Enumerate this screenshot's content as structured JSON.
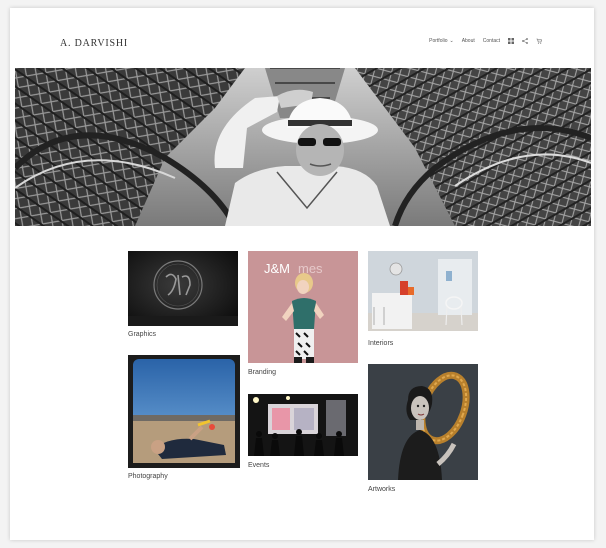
{
  "site": {
    "logo": "A. DARVISHI"
  },
  "nav": {
    "items": [
      {
        "label": "Portfolio",
        "has_dropdown": true
      },
      {
        "label": "About"
      },
      {
        "label": "Contact"
      }
    ],
    "icons": [
      "grid-icon",
      "share-icon",
      "cart-icon"
    ]
  },
  "hero": {
    "description": "none"
  },
  "gallery": {
    "graphics": {
      "caption": "Graphics"
    },
    "branding": {
      "caption": "Branding",
      "overlay_text": "J&M",
      "overlay_text_faint": "mes"
    },
    "interiors": {
      "caption": "Interiors"
    },
    "photography": {
      "caption": "Photography"
    },
    "events": {
      "caption": "Events"
    },
    "artworks": {
      "caption": "Artworks"
    }
  },
  "colors": {
    "page_bg": "#ffffff",
    "outer_bg": "#f3f3f3",
    "text": "#444444",
    "branding_bg": "#c89597"
  }
}
